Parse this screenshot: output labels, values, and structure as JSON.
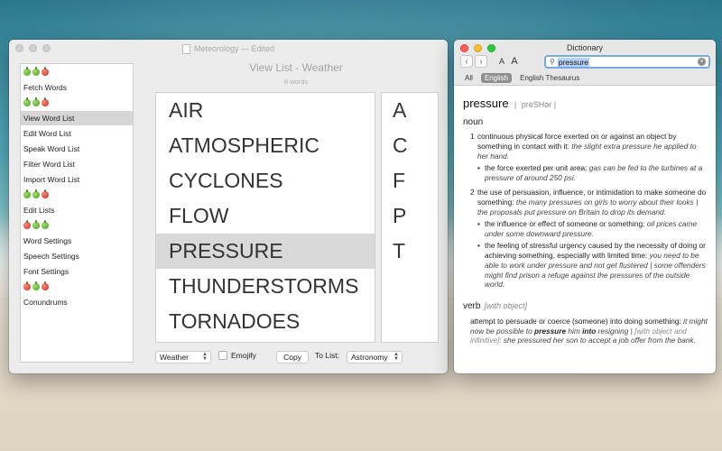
{
  "main_window": {
    "title": "Meteorology — Edited",
    "view_title": "View List - Weather",
    "word_count": "8 words",
    "sidebar": [
      {
        "type": "apples",
        "apples": [
          "green",
          "green",
          "red"
        ]
      },
      {
        "type": "item",
        "label": "Fetch Words"
      },
      {
        "type": "apples",
        "apples": [
          "green",
          "green",
          "red"
        ]
      },
      {
        "type": "item",
        "label": "View Word List",
        "selected": true
      },
      {
        "type": "item",
        "label": "Edit Word List"
      },
      {
        "type": "item",
        "label": "Speak Word List"
      },
      {
        "type": "item",
        "label": "Filter Word List"
      },
      {
        "type": "item",
        "label": "Import Word List"
      },
      {
        "type": "apples",
        "apples": [
          "green",
          "green",
          "red"
        ]
      },
      {
        "type": "item",
        "label": "Edit Lists"
      },
      {
        "type": "apples",
        "apples": [
          "red",
          "green",
          "green"
        ]
      },
      {
        "type": "item",
        "label": "Word Settings"
      },
      {
        "type": "item",
        "label": "Speech Settings"
      },
      {
        "type": "item",
        "label": "Font Settings"
      },
      {
        "type": "apples",
        "apples": [
          "red",
          "green",
          "red"
        ]
      },
      {
        "type": "item",
        "label": "Conundrums"
      }
    ],
    "words": [
      {
        "text": "AIR"
      },
      {
        "text": "ATMOSPHERIC"
      },
      {
        "text": "CYCLONES"
      },
      {
        "text": "FLOW"
      },
      {
        "text": "PRESSURE",
        "selected": true
      },
      {
        "text": "THUNDERSTORMS"
      },
      {
        "text": "TORNADOES"
      }
    ],
    "letters": [
      "A",
      "C",
      "F",
      "P",
      "T"
    ],
    "bottom": {
      "list_select": "Weather",
      "emojify_label": "Emojify",
      "copy_label": "Copy",
      "to_list_label": "To List:",
      "target_select": "Astronomy"
    }
  },
  "dictionary": {
    "title": "Dictionary",
    "search_value": "pressure",
    "tabs": [
      {
        "label": "All"
      },
      {
        "label": "English",
        "active": true
      },
      {
        "label": "English Thesaurus"
      }
    ],
    "headword": "pressure",
    "pronunciation": "| ˈpreSHər |",
    "noun_label": "noun",
    "sense1": {
      "num": "1",
      "def": "continuous physical force exerted on or against an object by something in contact with it:",
      "ex": "the slight extra pressure he applied to her hand.",
      "sub_def": "the force exerted per unit area:",
      "sub_ex": "gas can be fed to the turbines at a pressure of around 250 psi."
    },
    "sense2": {
      "num": "2",
      "def": "the use of persuasion, influence, or intimidation to make someone do something:",
      "ex": "the many pressures on girls to worry about their looks | the proposals put pressure on Britain to drop its demand.",
      "sub1_def": "the influence or effect of someone or something:",
      "sub1_ex": "oil prices came under some downward pressure.",
      "sub2_def": "the feeling of stressful urgency caused by the necessity of doing or achieving something, especially with limited time:",
      "sub2_ex": "you need to be able to work under pressure and not get flustered | some offenders might find prison a refuge against the pressures of the outside world."
    },
    "verb": {
      "label": "verb",
      "gram": "[with object]",
      "def": "attempt to persuade or coerce (someone) into doing something:",
      "ex1": "it might now be possible to",
      "bold1": "pressure",
      "ex2": "him",
      "bold2": "into",
      "ex3": "resigning |",
      "gram2": "[with object and infinitive]",
      "ex4": ": she pressured her son to accept a job offer from the bank."
    }
  }
}
